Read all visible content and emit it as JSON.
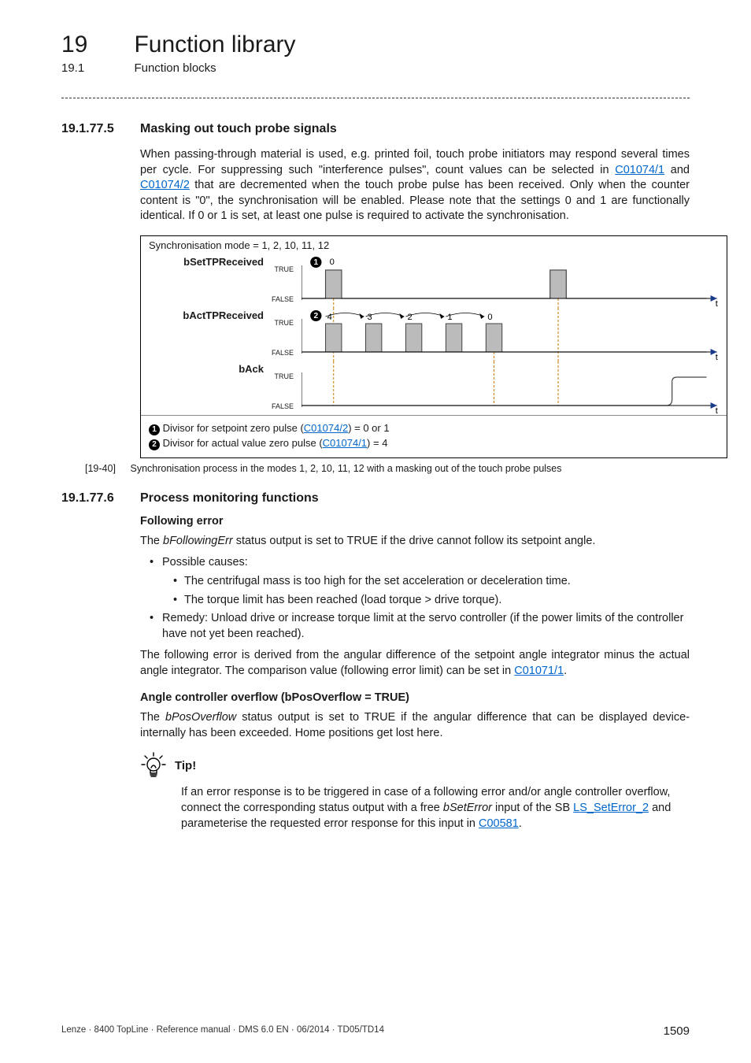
{
  "header": {
    "chapter_num": "19",
    "chapter_title": "Function library",
    "section_num": "19.1",
    "section_title": "Function blocks"
  },
  "sec1": {
    "num": "19.1.77.5",
    "title": "Masking out touch probe signals",
    "para": "When passing-through material is used, e.g. printed foil, touch probe initiators may respond several times per cycle. For suppressing such \"interference pulses\", count values can be selected in ",
    "link1": "C01074/1",
    "para_mid": " and ",
    "link2": "C01074/2",
    "para2": " that are decremented when the touch probe pulse has been received. Only when the counter content is \"0\", the synchronisation will be enabled. Please note that the settings 0 and 1 are functionally identical. If 0 or 1 is set, at least one pulse is required to activate the synchronisation."
  },
  "figure": {
    "heading": "Synchronisation mode = 1, 2, 10, 11, 12",
    "lane1_name": "bSetTPReceived",
    "lane2_name": "bActTPReceived",
    "lane3_name": "bAck",
    "ytrue": "TRUE",
    "yfalse": "FALSE",
    "marker1_label": "0",
    "marker2_labels": [
      "4",
      "3",
      "2",
      "1",
      "0"
    ],
    "t_label": "t",
    "legend1_pre": " Divisor for setpoint zero pulse (",
    "legend1_link": "C01074/2",
    "legend1_post": ") = 0 or 1",
    "legend2_pre": " Divisor for actual value zero pulse (",
    "legend2_link": "C01074/1",
    "legend2_post": ") = 4",
    "caption_num": "[19-40]",
    "caption_text": "Synchronisation process in the modes 1, 2, 10, 11, 12 with a masking out of the touch probe pulses"
  },
  "sec2": {
    "num": "19.1.77.6",
    "title": "Process monitoring functions",
    "sub1": "Following error",
    "p1_pre": "The ",
    "p1_em": "bFollowingErr",
    "p1_post": " status output is set to TRUE if the drive cannot follow its setpoint angle.",
    "b1": "Possible causes:",
    "b1a": "The centrifugal mass is too high for the set acceleration or deceleration time.",
    "b1b": "The torque limit has been reached (load torque > drive torque).",
    "b2": "Remedy: Unload drive or increase torque limit at the servo controller (if the power limits of the controller have not yet been reached).",
    "p2_pre": "The following error is derived from the angular difference of the setpoint angle integrator minus the actual angle integrator. The comparison value (following error limit) can be set in ",
    "p2_link": "C01071/1",
    "p2_post": ".",
    "sub2": "Angle controller overflow (bPosOverflow = TRUE)",
    "p3_pre": "The ",
    "p3_em": "bPosOverflow",
    "p3_post": " status output is set to TRUE if the angular difference that can be displayed device-internally has been exceeded. Home positions get lost here.",
    "tip_label": "Tip!",
    "tip_pre": "If an error response is to be triggered in case of a following error and/or angle controller overflow, connect the corresponding status output with a free ",
    "tip_em": "bSetError",
    "tip_mid": " input of the SB ",
    "tip_link1": "LS_SetError_2",
    "tip_mid2": " and parameterise the requested error response for this input in ",
    "tip_link2": "C00581",
    "tip_post": "."
  },
  "footer": "Lenze · 8400 TopLine · Reference manual · DMS 6.0 EN · 06/2014 · TD05/TD14",
  "page_number": "1509",
  "chart_data": [
    {
      "type": "pulse",
      "name": "bSetTPReceived",
      "ylabels": [
        "FALSE",
        "TRUE"
      ],
      "pulses_at": [
        30,
        310
      ],
      "annotations": [
        {
          "marker": "1",
          "label": "0",
          "at": 30
        }
      ],
      "xlabel": "t"
    },
    {
      "type": "pulse",
      "name": "bActTPReceived",
      "ylabels": [
        "FALSE",
        "TRUE"
      ],
      "pulses_at": [
        30,
        80,
        130,
        180,
        230
      ],
      "annotations": [
        {
          "marker": "2",
          "label": "4",
          "at": 30
        },
        {
          "label": "3",
          "at": 80
        },
        {
          "label": "2",
          "at": 130
        },
        {
          "label": "1",
          "at": 180
        },
        {
          "label": "0",
          "at": 230
        }
      ],
      "xlabel": "t"
    },
    {
      "type": "step",
      "name": "bAck",
      "ylabels": [
        "FALSE",
        "TRUE"
      ],
      "rises_at": 455,
      "xlabel": "t"
    }
  ]
}
